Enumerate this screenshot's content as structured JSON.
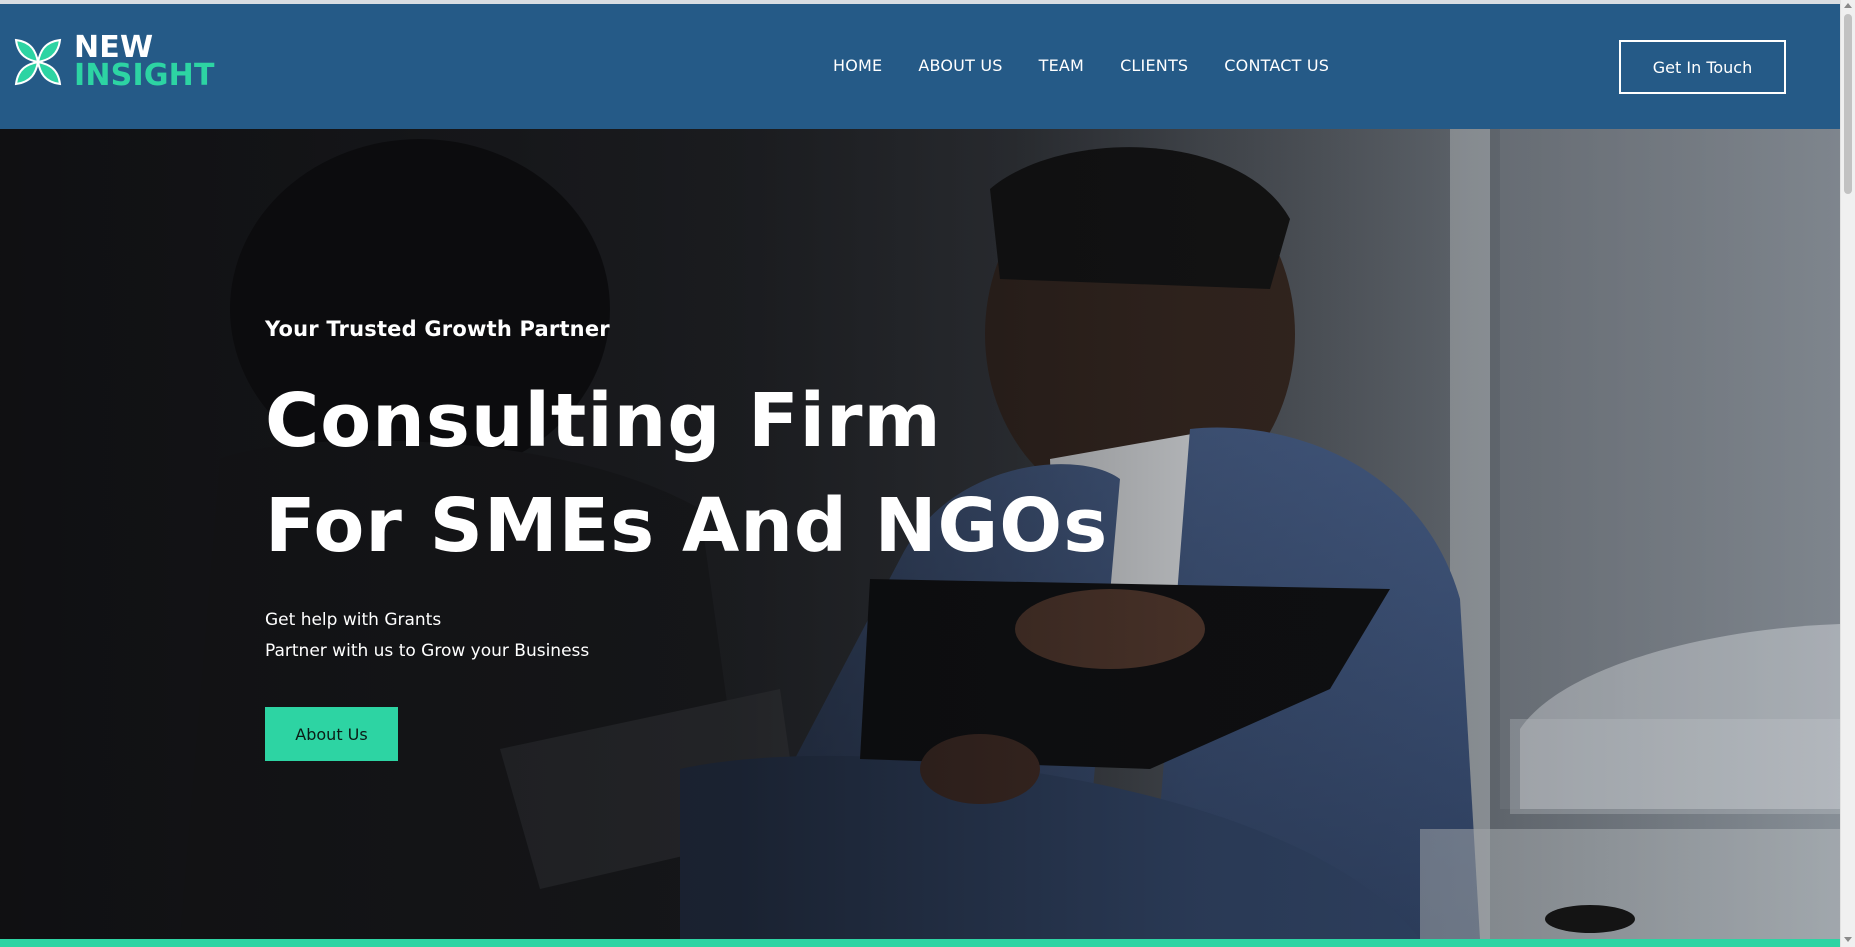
{
  "header": {
    "logo": {
      "line1": "NEW",
      "line2": "INSIGHT",
      "icon": "leaf-logo-icon"
    },
    "nav": [
      {
        "label": "HOME"
      },
      {
        "label": "ABOUT US"
      },
      {
        "label": "TEAM"
      },
      {
        "label": "CLIENTS"
      },
      {
        "label": "CONTACT US"
      }
    ],
    "cta_label": "Get In Touch"
  },
  "hero": {
    "tagline": "Your Trusted Growth Partner",
    "headline_line1": "Consulting Firm",
    "headline_line2": "For SMEs And NGOs",
    "sub_line1": "Get help with Grants",
    "sub_line2": "Partner with us to Grow your Business",
    "button_label": "About Us"
  },
  "colors": {
    "header_bg": "#255a87",
    "accent": "#2dd4a3",
    "text_light": "#ffffff"
  }
}
